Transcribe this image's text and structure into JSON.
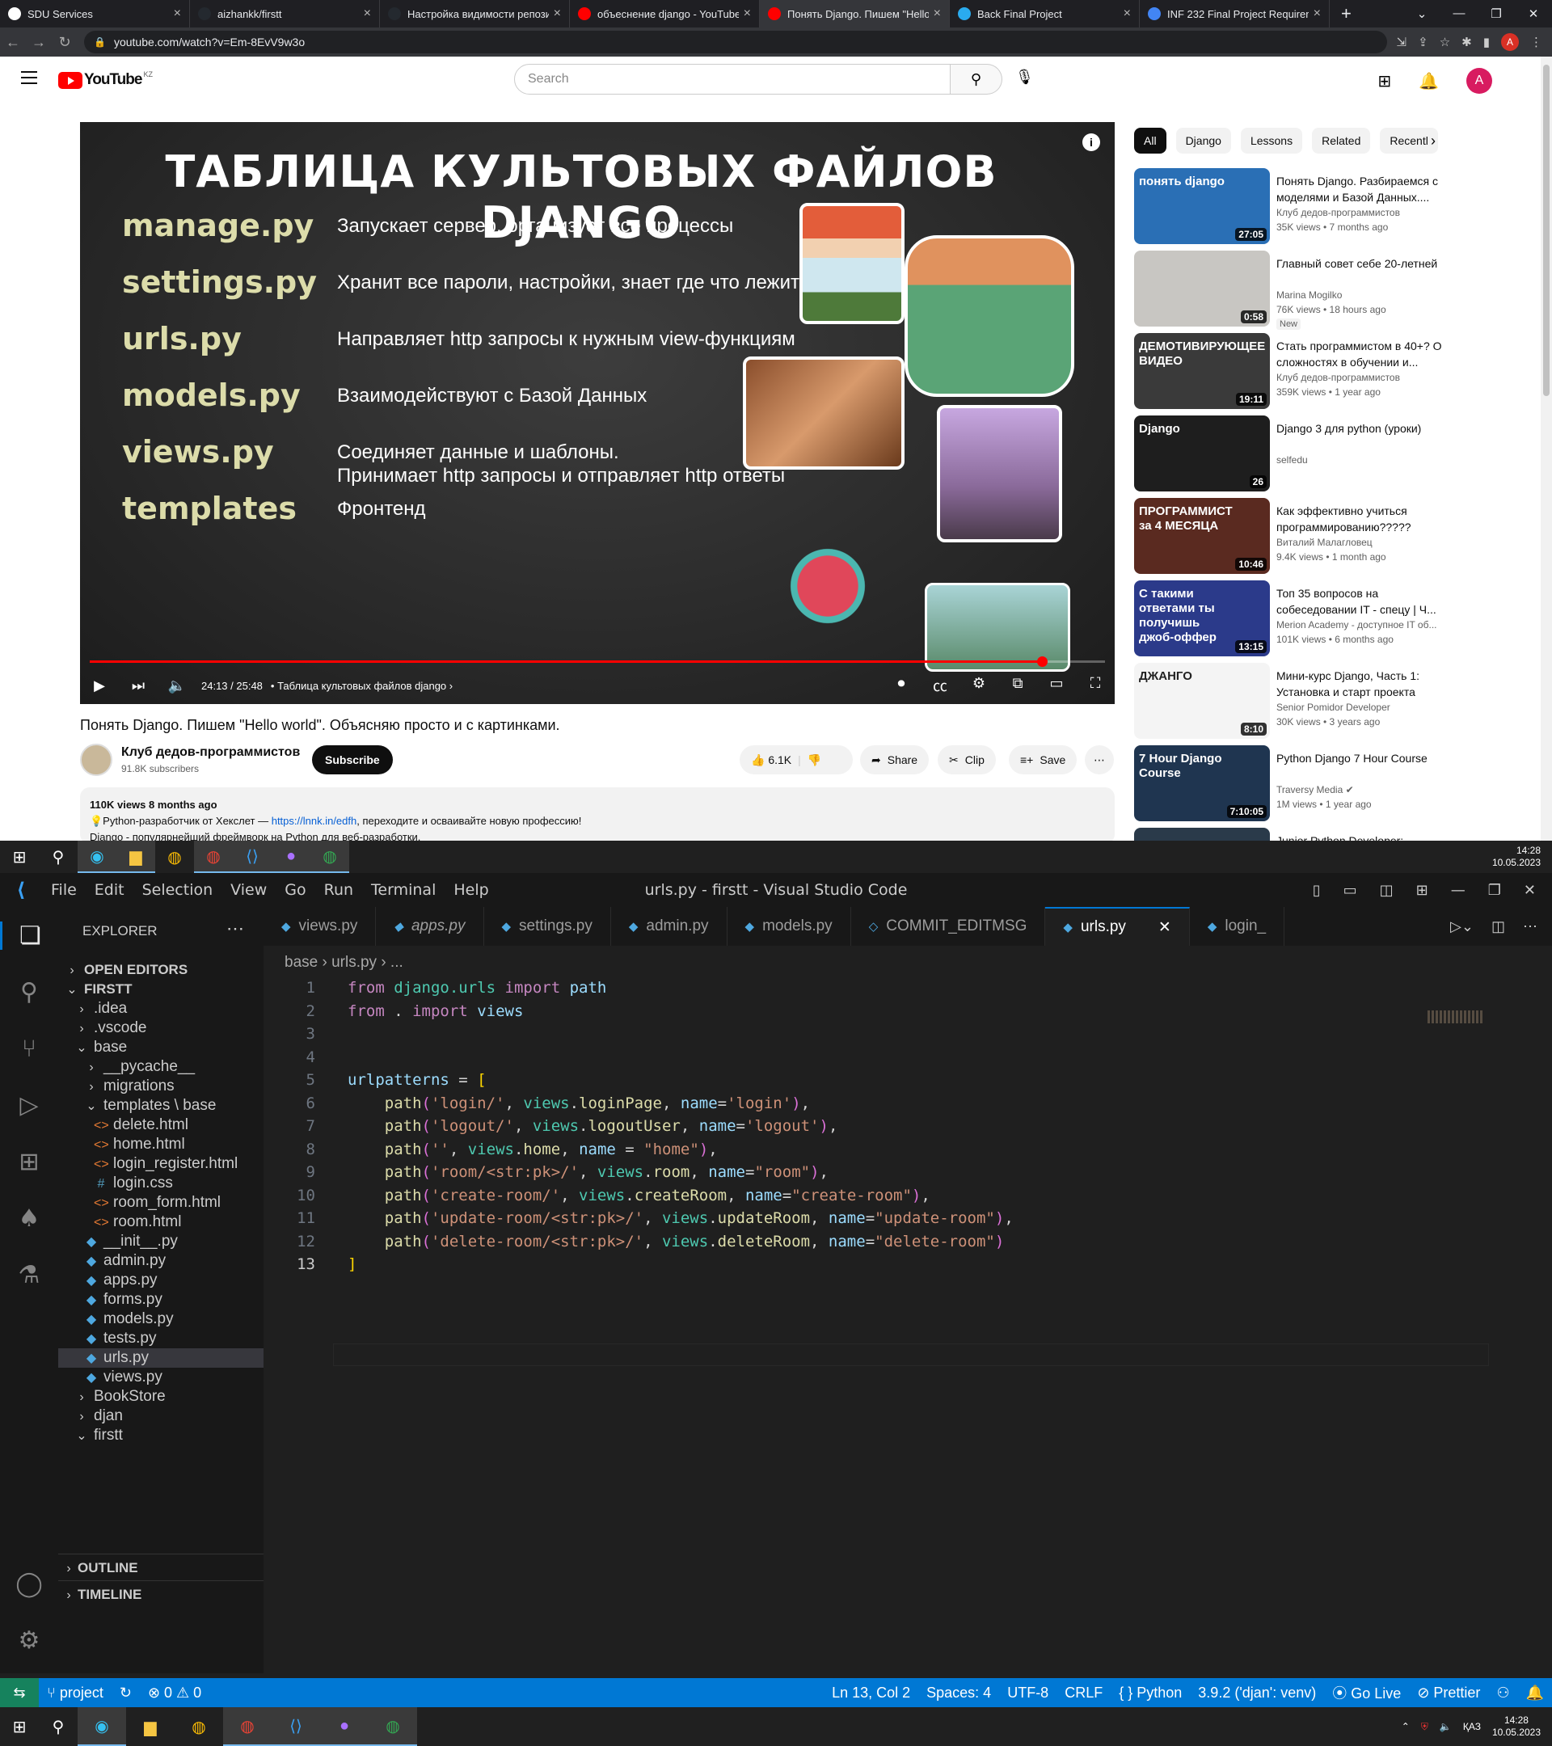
{
  "browser": {
    "tabs": [
      {
        "label": "SDU Services",
        "color": "#ffffff"
      },
      {
        "label": "aizhankk/firstt",
        "color": "#24292f"
      },
      {
        "label": "Настройка видимости репози",
        "color": "#24292f"
      },
      {
        "label": "объеснение django - YouTube",
        "color": "#ff0000"
      },
      {
        "label": "Понять Django. Пишем \"Hello",
        "color": "#ff0000",
        "active": true
      },
      {
        "label": "Back Final Project",
        "color": "#2aabee"
      },
      {
        "label": "INF 232 Final Project Requireme",
        "color": "#4285f4"
      }
    ],
    "new_tab": "+",
    "url": "youtube.com/watch?v=Em-8EvV9w3o",
    "profile_initial": "A"
  },
  "youtube": {
    "logo_text": "YouTube",
    "region": "KZ",
    "search_placeholder": "Search",
    "avatar_initial": "A",
    "video": {
      "slide_title": "ТАБЛИЦА КУЛЬТОВЫХ ФАЙЛОВ DJANGO",
      "files": [
        {
          "name": "manage.py",
          "desc": "Запускает сервер, организует все процессы"
        },
        {
          "name": "settings.py",
          "desc": "Хранит все пароли, настройки, знает где что лежит"
        },
        {
          "name": "urls.py",
          "desc": "Направляет http запросы к нужным view-функциям"
        },
        {
          "name": "models.py",
          "desc": "Взаимодействуют с Базой Данных"
        },
        {
          "name": "views.py",
          "desc": "Соединяет данные и шаблоны.\nПринимает http запросы и отправляет http ответы"
        },
        {
          "name": "templates",
          "desc": "Фронтенд"
        }
      ],
      "time": "24:13 / 25:48",
      "chapter": "Таблица культовых файлов django",
      "progress": 0.938,
      "title": "Понять Django. Пишем \"Hello world\". Объясняю просто и с картинками.",
      "channel": "Клуб дедов-программистов",
      "subscribers": "91.8K subscribers",
      "subscribe_label": "Subscribe",
      "likes": "6.1K",
      "share_label": "Share",
      "clip_label": "Clip",
      "save_label": "Save",
      "desc_meta": "110K views  8 months ago",
      "desc_line1_prefix": "💡Python-разработчик от Хекслет — ",
      "desc_link": "https://lnnk.in/edfh",
      "desc_line1_suffix": ", переходите и осваивайте новую профессию!",
      "desc_line2": "Django - популярнейший фреймворк на Python для веб-разработки."
    },
    "chips": [
      "All",
      "Django",
      "Lessons",
      "Related",
      "Recentl"
    ],
    "related": [
      {
        "title": "Понять Django. Разбираемся с моделями и Базой Данных....",
        "channel": "Клуб дедов-программистов",
        "meta": "35K views  •  7 months ago",
        "duration": "27:05",
        "thumb": "#2a6fb5",
        "thumb_text": "понять django"
      },
      {
        "title": "Главный совет себе 20-летней",
        "channel": "Marina Mogilko",
        "meta": "76K views  •  18 hours ago",
        "duration": "0:58",
        "thumb": "#c8c6c2",
        "badge": "New",
        "thumb_text": ""
      },
      {
        "title": "Стать программистом в 40+? О сложностях в обучении и...",
        "channel": "Клуб дедов-программистов",
        "meta": "359K views  •  1 year ago",
        "duration": "19:11",
        "thumb": "#3a3a3a",
        "thumb_text": "ДЕМОТИВИРУЮЩЕЕ ВИДЕО"
      },
      {
        "title": "Django 3 для python (уроки)",
        "channel": "selfedu",
        "meta": "",
        "duration": "26",
        "thumb": "#1e1e1e",
        "thumb_text": "Django"
      },
      {
        "title": "Как эффективно учиться программированию?????",
        "channel": "Виталий Малагловец",
        "meta": "9.4K views  •  1 month ago",
        "duration": "10:46",
        "thumb": "#5a2a20",
        "thumb_text": "ПРОГРАММИСТ за 4 МЕСЯЦА"
      },
      {
        "title": "Топ 35 вопросов на собеседовании IT - спецу | Ч...",
        "channel": "Merion Academy - доступное IT об...",
        "meta": "101K views  •  6 months ago",
        "duration": "13:15",
        "thumb": "#2b3a8a",
        "thumb_text": "С такими ответами ты получишь джоб-оффер"
      },
      {
        "title": "Мини-курс Django, Часть 1: Установка и старт проекта",
        "channel": "Senior Pomidor Developer",
        "meta": "30K views  •  3 years ago",
        "duration": "8:10",
        "thumb": "#f4f4f4",
        "thumb_text": "ДЖАНГО"
      },
      {
        "title": "Python Django 7 Hour Course",
        "channel": "Traversy Media ✔",
        "meta": "1M views  •  1 year ago",
        "duration": "7:10:05",
        "thumb": "#1f3550",
        "thumb_text": "7 Hour Django Course"
      },
      {
        "title": "Junior Python Developer:",
        "channel": "",
        "meta": "",
        "duration": "",
        "thumb": "#2a3a4a",
        "thumb_text": ""
      }
    ]
  },
  "taskbar_top": {
    "time": "14:28",
    "date": "10.05.2023"
  },
  "vscode": {
    "menu": [
      "File",
      "Edit",
      "Selection",
      "View",
      "Go",
      "Run",
      "Terminal",
      "Help"
    ],
    "window_title": "urls.py - firstt - Visual Studio Code",
    "explorer_title": "EXPLORER",
    "tree": [
      {
        "label": "OPEN EDITORS",
        "icon": "›",
        "depth": 0,
        "header": true
      },
      {
        "label": "FIRSTT",
        "icon": "⌄",
        "depth": 0,
        "header": true
      },
      {
        "label": ".idea",
        "icon": "›",
        "depth": 1
      },
      {
        "label": ".vscode",
        "icon": "›",
        "depth": 1
      },
      {
        "label": "base",
        "icon": "⌄",
        "depth": 1
      },
      {
        "label": "__pycache__",
        "icon": "›",
        "depth": 2
      },
      {
        "label": "migrations",
        "icon": "›",
        "depth": 2
      },
      {
        "label": "templates \\ base",
        "icon": "⌄",
        "depth": 2
      },
      {
        "label": "delete.html",
        "icon": "<>",
        "depth": 3,
        "color": "#e37933"
      },
      {
        "label": "home.html",
        "icon": "<>",
        "depth": 3,
        "color": "#e37933"
      },
      {
        "label": "login_register.html",
        "icon": "<>",
        "depth": 3,
        "color": "#e37933"
      },
      {
        "label": "login.css",
        "icon": "#",
        "depth": 3,
        "color": "#519aba"
      },
      {
        "label": "room_form.html",
        "icon": "<>",
        "depth": 3,
        "color": "#e37933"
      },
      {
        "label": "room.html",
        "icon": "<>",
        "depth": 3,
        "color": "#e37933"
      },
      {
        "label": "__init__.py",
        "icon": "◆",
        "depth": 2,
        "color": "#4ea8e0"
      },
      {
        "label": "admin.py",
        "icon": "◆",
        "depth": 2,
        "color": "#4ea8e0"
      },
      {
        "label": "apps.py",
        "icon": "◆",
        "depth": 2,
        "color": "#4ea8e0"
      },
      {
        "label": "forms.py",
        "icon": "◆",
        "depth": 2,
        "color": "#4ea8e0"
      },
      {
        "label": "models.py",
        "icon": "◆",
        "depth": 2,
        "color": "#4ea8e0"
      },
      {
        "label": "tests.py",
        "icon": "◆",
        "depth": 2,
        "color": "#4ea8e0"
      },
      {
        "label": "urls.py",
        "icon": "◆",
        "depth": 2,
        "color": "#4ea8e0",
        "selected": true
      },
      {
        "label": "views.py",
        "icon": "◆",
        "depth": 2,
        "color": "#4ea8e0"
      },
      {
        "label": "BookStore",
        "icon": "›",
        "depth": 1
      },
      {
        "label": "djan",
        "icon": "›",
        "depth": 1
      },
      {
        "label": "firstt",
        "icon": "⌄",
        "depth": 1
      }
    ],
    "outline_label": "OUTLINE",
    "timeline_label": "TIMELINE",
    "tabs": [
      "views.py",
      "apps.py",
      "settings.py",
      "admin.py",
      "models.py",
      "COMMIT_EDITMSG",
      "urls.py",
      "login_"
    ],
    "active_tab": "urls.py",
    "breadcrumb": "base  ›  urls.py  ›  ...",
    "code_lines": [
      [
        [
          "kw",
          "from"
        ],
        [
          "op",
          " "
        ],
        [
          "mod",
          "django.urls"
        ],
        [
          "op",
          " "
        ],
        [
          "kw",
          "import"
        ],
        [
          "op",
          " "
        ],
        [
          "var",
          "path"
        ]
      ],
      [
        [
          "kw",
          "from"
        ],
        [
          "op",
          " . "
        ],
        [
          "kw",
          "import"
        ],
        [
          "op",
          " "
        ],
        [
          "var",
          "views"
        ]
      ],
      [],
      [],
      [
        [
          "var",
          "urlpatterns"
        ],
        [
          "op",
          " = "
        ],
        [
          "br",
          "["
        ]
      ],
      [
        [
          "op",
          "    "
        ],
        [
          "fn",
          "path"
        ],
        [
          "br2",
          "("
        ],
        [
          "str",
          "'login/'"
        ],
        [
          "op",
          ", "
        ],
        [
          "mod",
          "views"
        ],
        [
          "op",
          "."
        ],
        [
          "fn",
          "loginPage"
        ],
        [
          "op",
          ", "
        ],
        [
          "var",
          "name"
        ],
        [
          "op",
          "="
        ],
        [
          "str",
          "'login'"
        ],
        [
          "br2",
          ")"
        ],
        [
          "op",
          ","
        ]
      ],
      [
        [
          "op",
          "    "
        ],
        [
          "fn",
          "path"
        ],
        [
          "br2",
          "("
        ],
        [
          "str",
          "'logout/'"
        ],
        [
          "op",
          ", "
        ],
        [
          "mod",
          "views"
        ],
        [
          "op",
          "."
        ],
        [
          "fn",
          "logoutUser"
        ],
        [
          "op",
          ", "
        ],
        [
          "var",
          "name"
        ],
        [
          "op",
          "="
        ],
        [
          "str",
          "'logout'"
        ],
        [
          "br2",
          ")"
        ],
        [
          "op",
          ","
        ]
      ],
      [
        [
          "op",
          "    "
        ],
        [
          "fn",
          "path"
        ],
        [
          "br2",
          "("
        ],
        [
          "str",
          "''"
        ],
        [
          "op",
          ", "
        ],
        [
          "mod",
          "views"
        ],
        [
          "op",
          "."
        ],
        [
          "fn",
          "home"
        ],
        [
          "op",
          ", "
        ],
        [
          "var",
          "name"
        ],
        [
          "op",
          " = "
        ],
        [
          "str",
          "\"home\""
        ],
        [
          "br2",
          ")"
        ],
        [
          "op",
          ","
        ]
      ],
      [
        [
          "op",
          "    "
        ],
        [
          "fn",
          "path"
        ],
        [
          "br2",
          "("
        ],
        [
          "str",
          "'room/<str:pk>/'"
        ],
        [
          "op",
          ", "
        ],
        [
          "mod",
          "views"
        ],
        [
          "op",
          "."
        ],
        [
          "fn",
          "room"
        ],
        [
          "op",
          ", "
        ],
        [
          "var",
          "name"
        ],
        [
          "op",
          "="
        ],
        [
          "str",
          "\"room\""
        ],
        [
          "br2",
          ")"
        ],
        [
          "op",
          ","
        ]
      ],
      [
        [
          "op",
          "    "
        ],
        [
          "fn",
          "path"
        ],
        [
          "br2",
          "("
        ],
        [
          "str",
          "'create-room/'"
        ],
        [
          "op",
          ", "
        ],
        [
          "mod",
          "views"
        ],
        [
          "op",
          "."
        ],
        [
          "fn",
          "createRoom"
        ],
        [
          "op",
          ", "
        ],
        [
          "var",
          "name"
        ],
        [
          "op",
          "="
        ],
        [
          "str",
          "\"create-room\""
        ],
        [
          "br2",
          ")"
        ],
        [
          "op",
          ","
        ]
      ],
      [
        [
          "op",
          "    "
        ],
        [
          "fn",
          "path"
        ],
        [
          "br2",
          "("
        ],
        [
          "str",
          "'update-room/<str:pk>/'"
        ],
        [
          "op",
          ", "
        ],
        [
          "mod",
          "views"
        ],
        [
          "op",
          "."
        ],
        [
          "fn",
          "updateRoom"
        ],
        [
          "op",
          ", "
        ],
        [
          "var",
          "name"
        ],
        [
          "op",
          "="
        ],
        [
          "str",
          "\"update-room\""
        ],
        [
          "br2",
          ")"
        ],
        [
          "op",
          ","
        ]
      ],
      [
        [
          "op",
          "    "
        ],
        [
          "fn",
          "path"
        ],
        [
          "br2",
          "("
        ],
        [
          "str",
          "'delete-room/<str:pk>/'"
        ],
        [
          "op",
          ", "
        ],
        [
          "mod",
          "views"
        ],
        [
          "op",
          "."
        ],
        [
          "fn",
          "deleteRoom"
        ],
        [
          "op",
          ", "
        ],
        [
          "var",
          "name"
        ],
        [
          "op",
          "="
        ],
        [
          "str",
          "\"delete-room\""
        ],
        [
          "br2",
          ")"
        ]
      ],
      [
        [
          "br",
          "]"
        ]
      ]
    ],
    "current_line": 13,
    "status": {
      "branch": "project",
      "problems": "⊗ 0 ⚠ 0",
      "position": "Ln 13, Col 2",
      "spaces": "Spaces: 4",
      "encoding": "UTF-8",
      "eol": "CRLF",
      "language": "Python",
      "interpreter": "3.9.2 ('djan': venv)",
      "golive": "Go Live",
      "prettier": "Prettier"
    }
  },
  "taskbar_bottom": {
    "lang": "ҚАЗ",
    "time": "14:28",
    "date": "10.05.2023"
  }
}
